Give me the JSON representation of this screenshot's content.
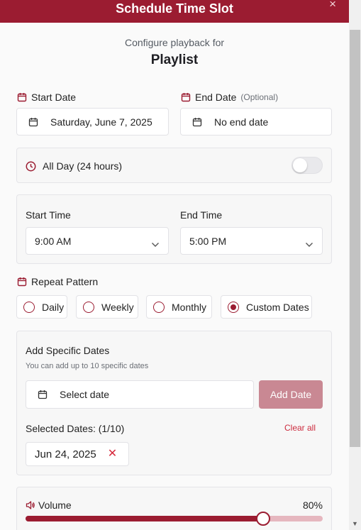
{
  "header": {
    "title": "Schedule Time Slot",
    "close": "×"
  },
  "intro": {
    "subtitle": "Configure playback for",
    "name": "Playlist"
  },
  "start_date": {
    "label": "Start Date",
    "value": "Saturday, June 7, 2025"
  },
  "end_date": {
    "label": "End Date",
    "optional": "(Optional)",
    "value": "No end date"
  },
  "all_day": {
    "label": "All Day (24 hours)",
    "enabled": false
  },
  "times": {
    "start_label": "Start Time",
    "start_value": "9:00 AM",
    "end_label": "End Time",
    "end_value": "5:00 PM"
  },
  "repeat": {
    "label": "Repeat Pattern",
    "options": [
      "Daily",
      "Weekly",
      "Monthly",
      "Custom Dates"
    ],
    "selected": "Custom Dates"
  },
  "specific_dates": {
    "title": "Add Specific Dates",
    "hint": "You can add up to 10 specific dates",
    "picker_placeholder": "Select date",
    "add_button": "Add Date",
    "selected_label": "Selected Dates: (1/10)",
    "clear_all": "Clear all",
    "dates": [
      "Jun 24, 2025"
    ],
    "remove_glyph": "✕"
  },
  "volume": {
    "label": "Volume",
    "value_text": "80%",
    "value": 0.8
  },
  "colors": {
    "accent": "#9b1c31",
    "accent_light": "#c98893",
    "danger": "#cc2b3e"
  }
}
